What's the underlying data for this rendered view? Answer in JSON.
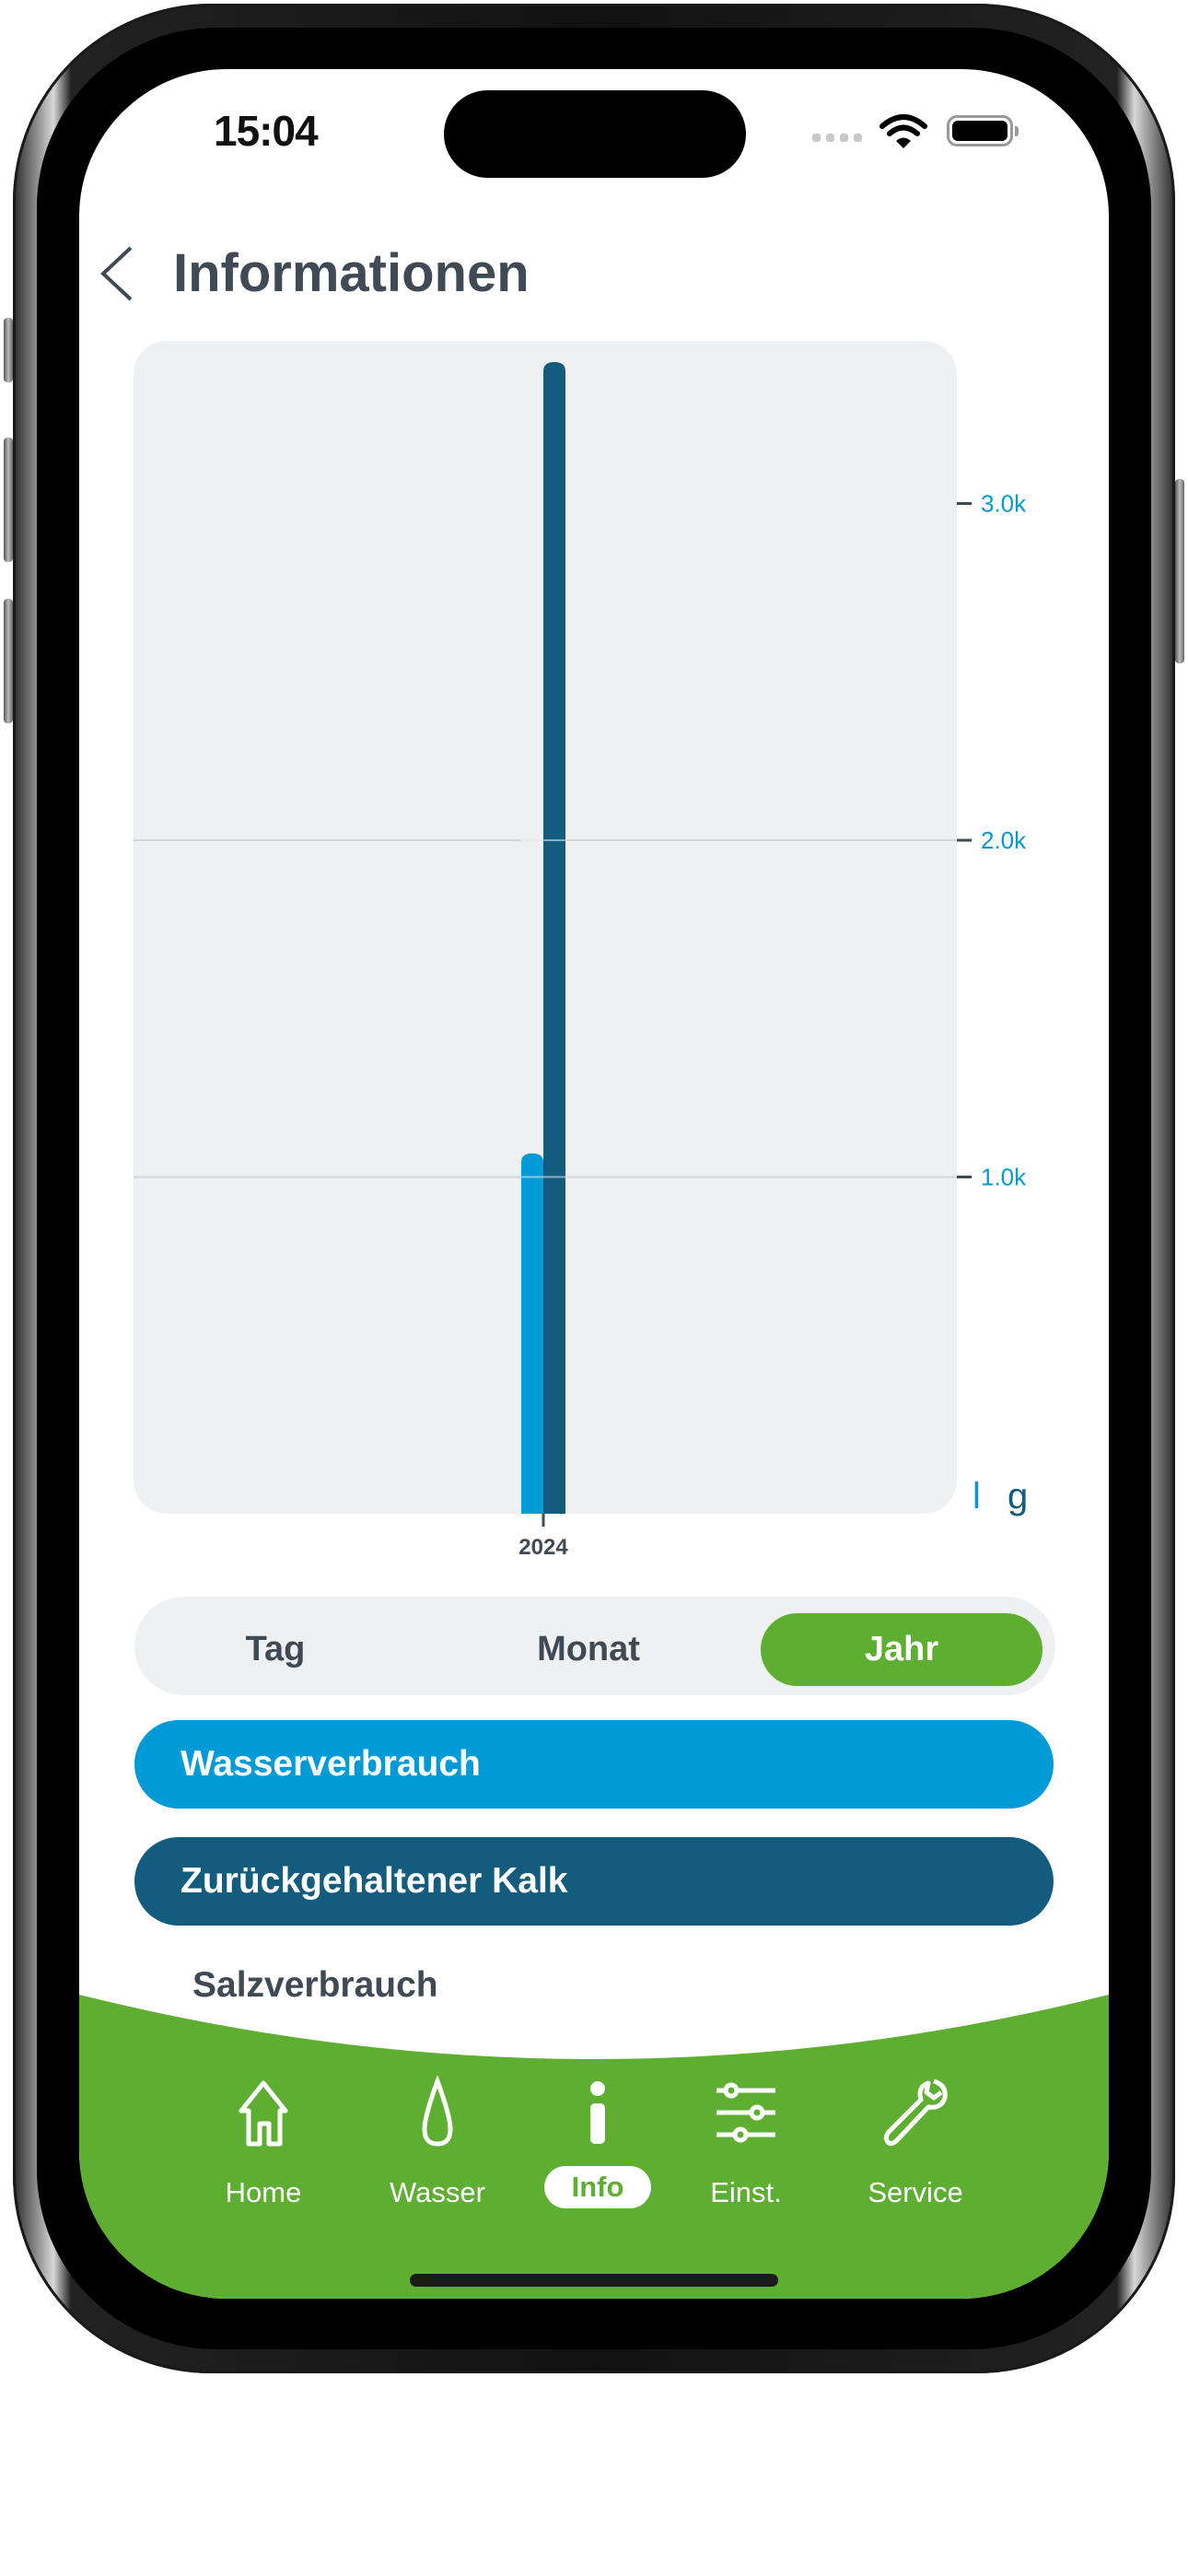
{
  "status_bar": {
    "time": "15:04"
  },
  "header": {
    "title": "Informationen",
    "back_icon": "chevron-left-icon"
  },
  "chart_data": {
    "type": "bar",
    "categories": [
      "2024"
    ],
    "series": [
      {
        "name": "Wasserverbrauch",
        "unit": "l",
        "color": "#009bd6",
        "values": [
          1070
        ]
      },
      {
        "name": "Zurückgehaltener Kalk",
        "unit": "g",
        "color": "#135c7e",
        "values": [
          3420
        ]
      }
    ],
    "yticks": [
      1000,
      2000,
      3000
    ],
    "ytick_labels": [
      "1.0k",
      "2.0k",
      "3.0k"
    ],
    "ylim": [
      0,
      3450
    ],
    "yaxis_position": "right",
    "unit_labels": [
      "l",
      "g"
    ],
    "grid": true,
    "title": "",
    "xlabel": "",
    "ylabel": ""
  },
  "period_selector": {
    "options": [
      "Tag",
      "Monat",
      "Jahr"
    ],
    "selected": "Jahr"
  },
  "series_toggles": [
    {
      "label": "Wasserverbrauch",
      "active": true,
      "color": "#009bd6"
    },
    {
      "label": "Zurückgehaltener Kalk",
      "active": true,
      "color": "#135c7e"
    },
    {
      "label": "Salzverbrauch",
      "active": false
    }
  ],
  "bottom_nav": {
    "items": [
      {
        "label": "Home",
        "icon": "home-icon"
      },
      {
        "label": "Wasser",
        "icon": "water-drop-icon"
      },
      {
        "label": "Info",
        "icon": "info-icon",
        "active": true
      },
      {
        "label": "Einst.",
        "icon": "sliders-icon"
      },
      {
        "label": "Service",
        "icon": "wrench-icon"
      }
    ]
  },
  "colors": {
    "brand_green": "#5dae31",
    "water_blue": "#009bd6",
    "lime_dark_blue": "#135c7e",
    "text_dark": "#3f4a55"
  }
}
